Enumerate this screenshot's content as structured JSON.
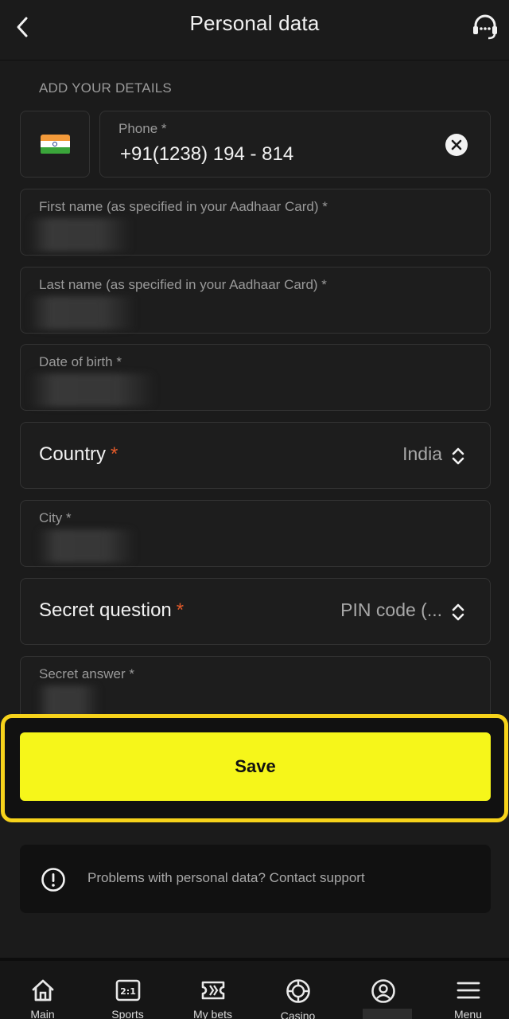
{
  "header": {
    "title": "Personal data",
    "back_icon": "chevron-left-icon",
    "support_icon": "headset-icon"
  },
  "section_label": "ADD YOUR DETAILS",
  "phone": {
    "flag": "india-flag-icon",
    "label": "Phone *",
    "value": "+91(1238) 194 - 814",
    "clear_icon": "clear-icon"
  },
  "fields": {
    "first_name_label": "First name (as specified in your Aadhaar Card) *",
    "last_name_label": "Last name (as specified in your Aadhaar Card) *",
    "dob_label": "Date of birth *",
    "city_label": "City *",
    "secret_answer_label": "Secret answer *"
  },
  "country": {
    "label": "Country",
    "required_mark": "*",
    "value": "India"
  },
  "secret_question": {
    "label": "Secret question",
    "required_mark": "*",
    "value": "PIN code (..."
  },
  "save_label": "Save",
  "support_note": {
    "icon": "exclamation-circle-icon",
    "text": "Problems with personal data? Contact support"
  },
  "nav": [
    {
      "label": "Main",
      "icon": "home-icon"
    },
    {
      "label": "Sports",
      "icon": "scoreboard-icon"
    },
    {
      "label": "My bets",
      "icon": "ticket-icon"
    },
    {
      "label": "Casino",
      "icon": "chip-icon"
    },
    {
      "label": "",
      "icon": "profile-icon"
    },
    {
      "label": "Menu",
      "icon": "hamburger-icon"
    }
  ],
  "colors": {
    "background": "#1b1b1b",
    "accent_yellow": "#f6f61a",
    "highlight_border": "#f7d31b",
    "required": "#e25a2a"
  }
}
